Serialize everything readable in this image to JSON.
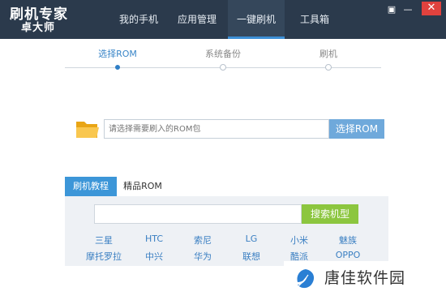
{
  "app": {
    "title": "刷机专家",
    "subtitle": "卓大师"
  },
  "nav": {
    "items": [
      {
        "label": "我的手机"
      },
      {
        "label": "应用管理"
      },
      {
        "label": "一键刷机"
      },
      {
        "label": "工具箱"
      }
    ],
    "active_index": 2
  },
  "window": {
    "menu_glyph": "▣",
    "minimize_glyph": "—",
    "close_glyph": "✕"
  },
  "steps": {
    "items": [
      {
        "label": "选择ROM"
      },
      {
        "label": "系统备份"
      },
      {
        "label": "刷机"
      }
    ],
    "current_index": 0
  },
  "rom_select": {
    "placeholder": "请选择需要刷入的ROM包",
    "button_label": "选择ROM",
    "icon": "folder-icon"
  },
  "tabs": {
    "items": [
      {
        "label": "刷机教程"
      },
      {
        "label": "精品ROM"
      }
    ],
    "active_index": 0
  },
  "search": {
    "value": "",
    "button_label": "搜索机型"
  },
  "brands": {
    "row1": [
      "三星",
      "HTC",
      "索尼",
      "LG",
      "小米",
      "魅族"
    ],
    "row2": [
      "摩托罗拉",
      "中兴",
      "华为",
      "联想",
      "酷派",
      "OPPO"
    ]
  },
  "watermark": {
    "text": "唐佳软件园",
    "icon": "leaf-logo-icon"
  },
  "colors": {
    "titlebar": "#2b3a4c",
    "accent": "#3c96d8",
    "rom_button": "#6fa9db",
    "search_button": "#8cc63f",
    "brand_link": "#3a7fc2",
    "close_button": "#e0423e"
  }
}
